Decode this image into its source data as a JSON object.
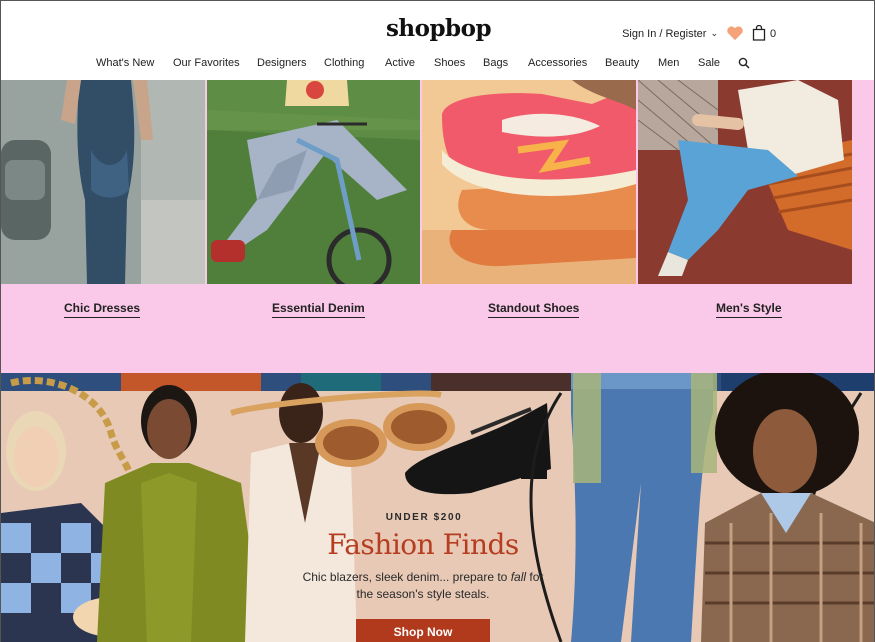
{
  "header": {
    "logo": "shopbop",
    "account_label": "Sign In / Register",
    "bag_count": "0"
  },
  "nav": {
    "items": [
      "What's New",
      "Our Favorites",
      "Designers",
      "Clothing",
      "Active",
      "Shoes",
      "Bags",
      "Accessories",
      "Beauty",
      "Men",
      "Sale"
    ]
  },
  "categories": [
    {
      "label": "Chic Dresses"
    },
    {
      "label": "Essential Denim"
    },
    {
      "label": "Standout Shoes"
    },
    {
      "label": "Men's Style"
    }
  ],
  "banner": {
    "kicker": "UNDER $200",
    "headline": "Fashion Finds",
    "sub_before": "Chic blazers, sleek denim... prepare to ",
    "sub_em": "fall",
    "sub_after": " for the season's style steals.",
    "cta": "Shop Now"
  },
  "colors": {
    "category_bg": "#fac8e8",
    "accent": "#b63d20",
    "banner_bg": "#e7c9b5",
    "heart": "#f5a27a"
  }
}
